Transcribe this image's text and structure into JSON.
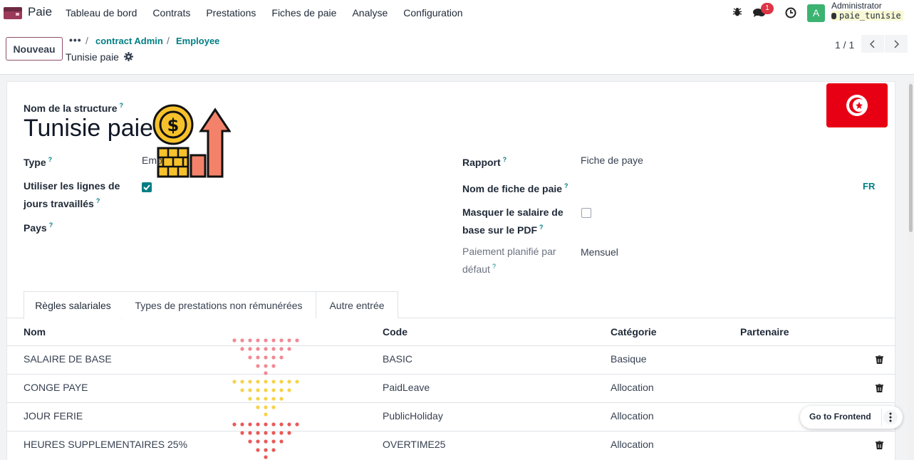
{
  "navbar": {
    "app_name": "Paie",
    "menu": [
      "Tableau de bord",
      "Contrats",
      "Prestations",
      "Fiches de paie",
      "Analyse",
      "Configuration"
    ],
    "notification_count": "1",
    "user_initial": "A",
    "user_name": "Administrator",
    "db_name": "paie_tunisie"
  },
  "control": {
    "new_label": "Nouveau",
    "breadcrumb_more": "•••",
    "breadcrumb": [
      "contract Admin",
      "Employee"
    ],
    "record_title": "Tunisie paie",
    "pager": "1 / 1"
  },
  "form": {
    "structure_label": "Nom de la structure",
    "structure_name": "Tunisie paie",
    "type_label": "Type",
    "type_value": "Emp",
    "worked_days_label_1": "Utiliser les lignes de",
    "worked_days_label_2": "jours travaillés",
    "worked_days_checked": true,
    "country_label": "Pays",
    "report_label": "Rapport",
    "report_value": "Fiche de paye",
    "payslip_name_label": "Nom de fiche de paie",
    "payslip_lang": "FR",
    "hide_salary_label_1": "Masquer le salaire de",
    "hide_salary_label_2": "base sur le PDF",
    "hide_salary_checked": false,
    "schedule_label_1": "Paiement planifié par",
    "schedule_label_2": "défaut",
    "schedule_value": "Mensuel",
    "help_mark": "?"
  },
  "tabs": [
    "Règles salariales",
    "Types de prestations non rémunérées",
    "Autre entrée"
  ],
  "table": {
    "columns": [
      "Nom",
      "Code",
      "Catégorie",
      "Partenaire"
    ],
    "rows": [
      {
        "name": "SALAIRE DE BASE",
        "code": "BASIC",
        "category": "Basique"
      },
      {
        "name": "CONGE PAYE",
        "code": "PaidLeave",
        "category": "Allocation"
      },
      {
        "name": "JOUR FERIE",
        "code": "PublicHoliday",
        "category": "Allocation"
      },
      {
        "name": "HEURES SUPPLEMENTAIRES 25%",
        "code": "OVERTIME25",
        "category": "Allocation"
      }
    ]
  },
  "floating": {
    "label": "Go to Frontend"
  },
  "colors": {
    "accent": "#017e84",
    "brand": "#8f4e6a",
    "flag_red": "#e70013"
  },
  "icons": [
    "bug-icon",
    "chat-icon",
    "clock-icon",
    "gear-icon",
    "chevron-left-icon",
    "chevron-right-icon",
    "trash-icon",
    "kebab-icon"
  ]
}
